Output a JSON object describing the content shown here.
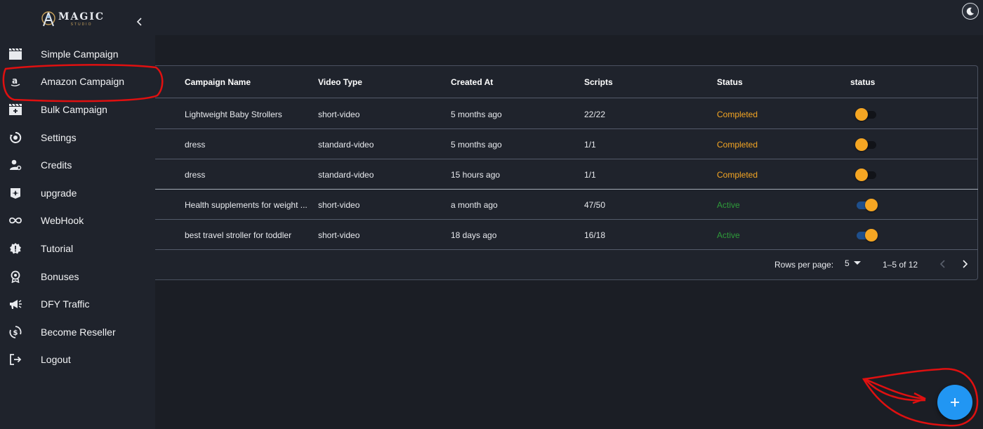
{
  "brand": {
    "name": "MAGIC",
    "sub": "STUDIO"
  },
  "sidebar": {
    "items": [
      {
        "label": "Simple Campaign",
        "icon": "clapperboard-icon"
      },
      {
        "label": "Amazon Campaign",
        "icon": "amazon-icon"
      },
      {
        "label": "Bulk Campaign",
        "icon": "bulk-video-icon"
      },
      {
        "label": "Settings",
        "icon": "settings-icon"
      },
      {
        "label": "Credits",
        "icon": "user-gear-icon"
      },
      {
        "label": "upgrade",
        "icon": "upgrade-icon"
      },
      {
        "label": "WebHook",
        "icon": "infinity-icon"
      },
      {
        "label": "Tutorial",
        "icon": "badge-alert-icon"
      },
      {
        "label": "Bonuses",
        "icon": "award-icon"
      },
      {
        "label": "DFY Traffic",
        "icon": "megaphone-icon"
      },
      {
        "label": "Become Reseller",
        "icon": "dollar-cycle-icon"
      },
      {
        "label": "Logout",
        "icon": "logout-icon"
      }
    ]
  },
  "table": {
    "columns": [
      "Campaign Name",
      "Video Type",
      "Created At",
      "Scripts",
      "Status",
      "status"
    ],
    "rows": [
      {
        "name": "Lightweight Baby Strollers",
        "type": "short-video",
        "created": "5 months ago",
        "scripts": "22/22",
        "status": "Completed",
        "toggle": false
      },
      {
        "name": "dress",
        "type": "standard-video",
        "created": "5 months ago",
        "scripts": "1/1",
        "status": "Completed",
        "toggle": false
      },
      {
        "name": "dress",
        "type": "standard-video",
        "created": "15 hours ago",
        "scripts": "1/1",
        "status": "Completed",
        "toggle": false
      },
      {
        "name": "Health supplements for weight ...",
        "type": "short-video",
        "created": "a month ago",
        "scripts": "47/50",
        "status": "Active",
        "toggle": true
      },
      {
        "name": "best travel stroller for toddler",
        "type": "short-video",
        "created": "18 days ago",
        "scripts": "16/18",
        "status": "Active",
        "toggle": true
      }
    ]
  },
  "pagination": {
    "rows_per_page_label": "Rows per page:",
    "rows_per_page_value": "5",
    "range": "1–5 of 12"
  },
  "colors": {
    "completed": "#f5a623",
    "active": "#2e9b3a",
    "fab": "#2196f3",
    "annotation": "#e01010"
  }
}
